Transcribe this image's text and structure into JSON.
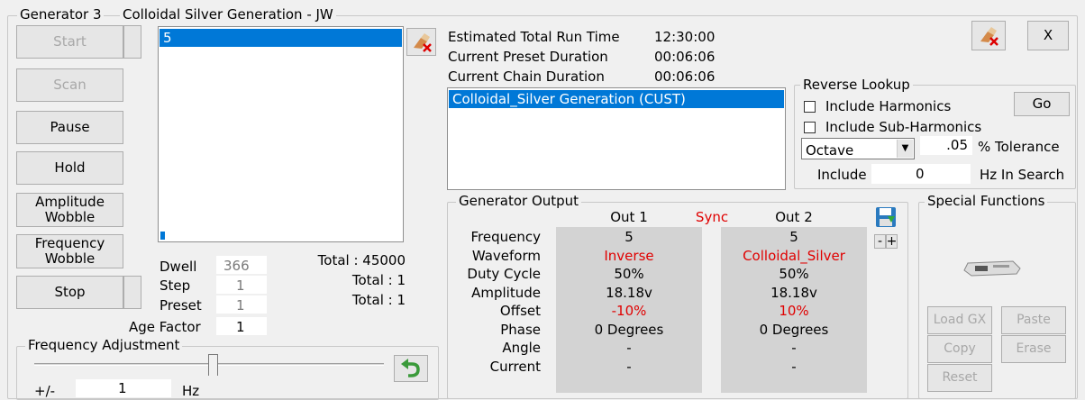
{
  "header": {
    "gen_label": "Generator 3",
    "title": "Colloidal Silver Generation - JW"
  },
  "buttons": {
    "start": "Start",
    "scan": "Scan",
    "pause": "Pause",
    "hold": "Hold",
    "amp_wobble": "Amplitude Wobble",
    "freq_wobble": "Frequency Wobble",
    "stop": "Stop",
    "close": "X",
    "go": "Go",
    "minus": "-",
    "plus": "+",
    "load_gx": "Load GX",
    "paste": "Paste",
    "copy": "Copy",
    "erase": "Erase",
    "reset": "Reset"
  },
  "program_list": {
    "items": [
      "5"
    ]
  },
  "counters": {
    "dwell_label": "Dwell",
    "dwell_value": "366",
    "step_label": "Step",
    "step_value": "1",
    "preset_label": "Preset",
    "preset_value": "1",
    "age_label": "Age Factor",
    "age_value": "1",
    "total1": "Total : 45000",
    "total2": "Total : 1",
    "total3": "Total : 1"
  },
  "freq_adjust": {
    "legend": "Frequency Adjustment",
    "pm_label": "+/-",
    "value": "1",
    "unit": "Hz"
  },
  "runtime": {
    "est_label": "Estimated Total Run Time",
    "est_value": "12:30:00",
    "preset_label": "Current Preset Duration",
    "preset_value": "00:06:06",
    "chain_label": "Current Chain Duration",
    "chain_value": "00:06:06"
  },
  "chain_list": {
    "items": [
      "Colloidal_Silver Generation (CUST)"
    ]
  },
  "reverse_lookup": {
    "legend": "Reverse Lookup",
    "harmonics": "Include Harmonics",
    "subharmonics": "Include Sub-Harmonics",
    "select_value": "Octave",
    "tolerance_value": ".05",
    "tolerance_label": "% Tolerance",
    "include_label": "Include",
    "include_value": "0",
    "search_label": "Hz In Search"
  },
  "output": {
    "legend": "Generator Output",
    "out1": "Out 1",
    "sync": "Sync",
    "out2": "Out 2",
    "rows": [
      {
        "label": "Frequency",
        "v1": "5",
        "v2": "5",
        "red": false
      },
      {
        "label": "Waveform",
        "v1": "Inverse",
        "v2": "Colloidal_Silver",
        "red": true
      },
      {
        "label": "Duty Cycle",
        "v1": "50%",
        "v2": "50%",
        "red": false
      },
      {
        "label": "Amplitude",
        "v1": "18.18v",
        "v2": "18.18v",
        "red": false
      },
      {
        "label": "Offset",
        "v1": "-10%",
        "v2": "10%",
        "red": true
      },
      {
        "label": "Phase",
        "v1": "0 Degrees",
        "v2": "0 Degrees",
        "red": false
      },
      {
        "label": "Angle",
        "v1": "-",
        "v2": "-",
        "red": false
      },
      {
        "label": "Current",
        "v1": "-",
        "v2": "-",
        "red": false
      }
    ]
  },
  "special": {
    "legend": "Special Functions"
  },
  "colors": {
    "selection": "#0078d7",
    "red_text": "#e00000",
    "panel": "#d3d3d3"
  },
  "icons": [
    "eraser-icon",
    "save-icon",
    "undo-arrow-icon",
    "device-icon"
  ]
}
